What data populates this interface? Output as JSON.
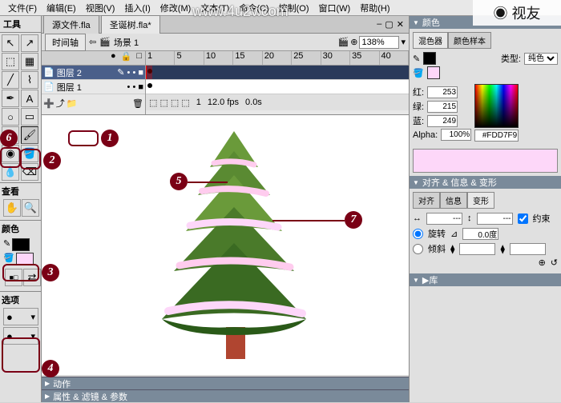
{
  "watermark": "www.4u2v.com",
  "logo": "◉ 视友",
  "menu": [
    "文件(F)",
    "编辑(E)",
    "视图(V)",
    "插入(I)",
    "修改(M)",
    "文本(T)",
    "命令(C)",
    "控制(O)",
    "窗口(W)",
    "帮助(H)"
  ],
  "toolbox": {
    "title": "工具",
    "view": "查看",
    "colors": "颜色",
    "options": "选项"
  },
  "tabs": {
    "t1": "源文件.fla",
    "t2": "圣诞树.fla*"
  },
  "timeline": {
    "btn": "时间轴",
    "scene": "场景 1",
    "layer2": "图层 2",
    "layer1": "图层 1",
    "frame": "1",
    "fps": "12.0 fps",
    "time": "0.0s"
  },
  "ruler": [
    "1",
    "5",
    "10",
    "15",
    "20",
    "25",
    "30",
    "35",
    "40"
  ],
  "zoom": "138%",
  "bottom": {
    "actions": "动作",
    "props": "属性 & 滤镜 & 参数"
  },
  "color_panel": {
    "title": "颜色",
    "tab1": "混色器",
    "tab2": "颜色样本",
    "type_lbl": "类型:",
    "type": "纯色",
    "r": "红:",
    "r_v": "253",
    "g": "绿:",
    "g_v": "215",
    "b": "蓝:",
    "b_v": "249",
    "a": "Alpha:",
    "a_v": "100%",
    "hex": "#FDD7F9"
  },
  "align_panel": {
    "title": "对齐 & 信息 & 变形",
    "tab1": "对齐",
    "tab2": "信息",
    "tab3": "变形",
    "w": "---",
    "h": "---",
    "constrain": "约束",
    "rotate": "旋转",
    "angle": "0.0度",
    "skew": "倾斜"
  },
  "lib": "库",
  "annotations": {
    "a1": "1",
    "a2": "2",
    "a3": "3",
    "a4": "4",
    "a5": "5",
    "a6": "6",
    "a7": "7"
  }
}
